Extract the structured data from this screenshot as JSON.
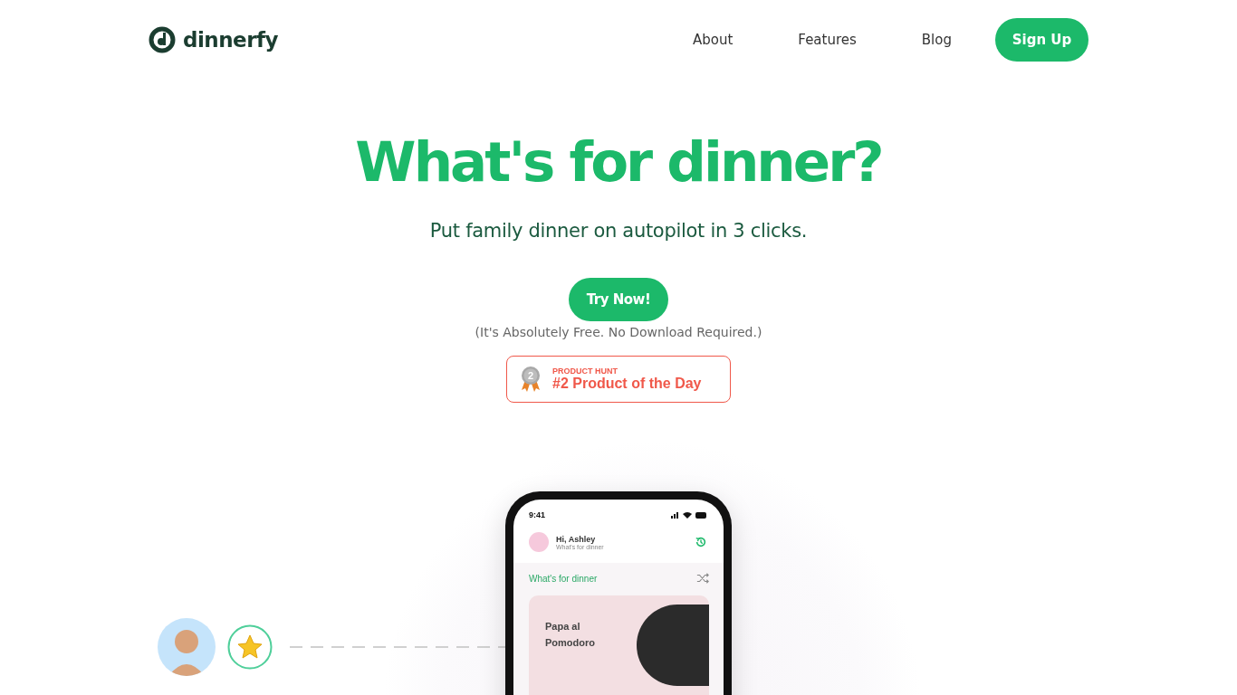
{
  "header": {
    "logo": "dinnerfy",
    "nav": [
      {
        "label": "About"
      },
      {
        "label": "Features"
      },
      {
        "label": "Blog"
      }
    ],
    "signup": "Sign Up"
  },
  "hero": {
    "title": "What's for dinner?",
    "subtitle": "Put family dinner on autopilot in 3 clicks.",
    "cta": "Try Now!",
    "note": "(It's Absolutely Free. No Download Required.)"
  },
  "badge": {
    "rank": "2",
    "eyebrow": "PRODUCT HUNT",
    "title": "#2 Product of the Day"
  },
  "phone": {
    "time": "9:41",
    "greeting": "Hi, Ashley",
    "greeting_sub": "What's for dinner",
    "section": "What's for dinner",
    "dish": "Papa al Pomodoro"
  }
}
